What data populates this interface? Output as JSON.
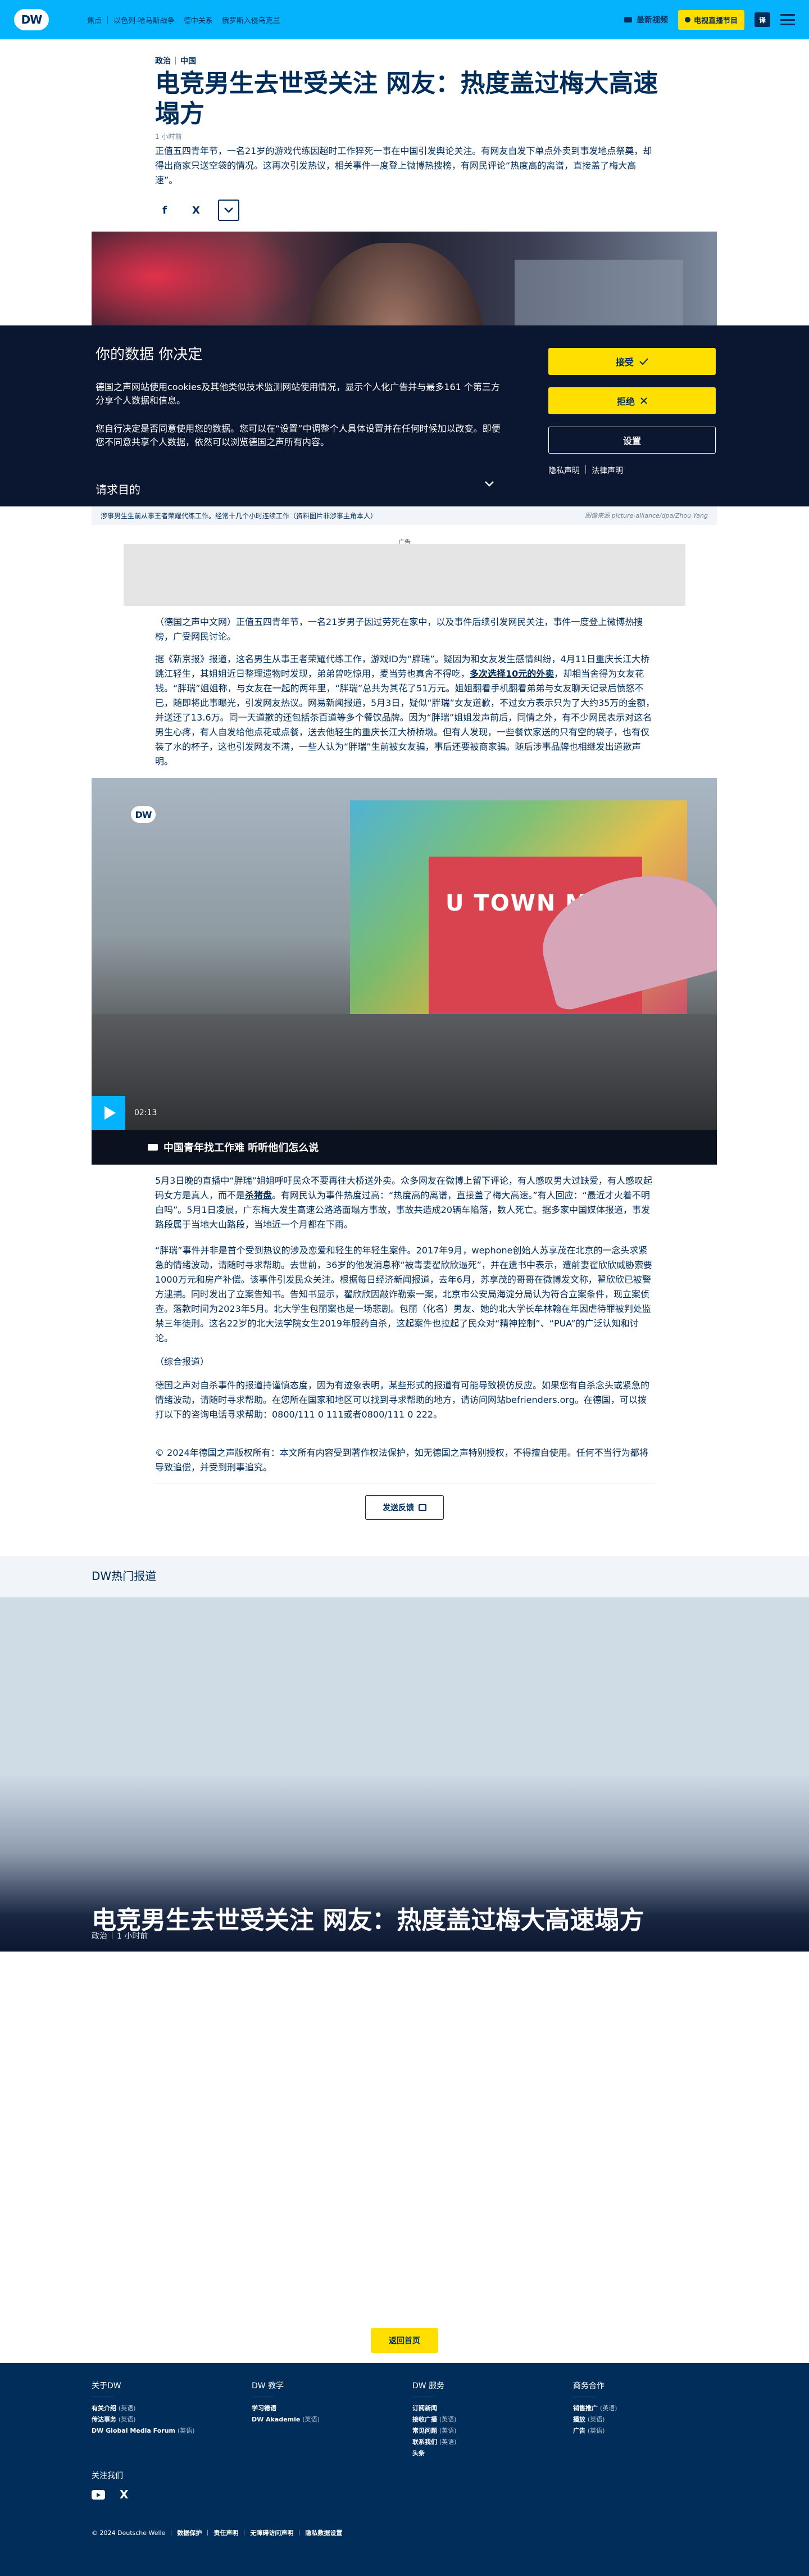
{
  "header": {
    "logo": "DW",
    "hot_label": "焦点",
    "hot_links": [
      "以色列-哈马斯战争",
      "德中关系",
      "俄罗斯入侵乌克兰"
    ],
    "latest_video": "最新视频",
    "tv_button": "电视直播节目",
    "lang": "译"
  },
  "article": {
    "kicker": [
      "政治",
      "中国"
    ],
    "title": "电竞男生去世受关注 网友：热度盖过梅大高速塌方",
    "time_ago": "1 小时前",
    "teaser": "正值五四青年节，一名21岁的游戏代练因超时工作猝死一事在中国引发舆论关注。有网友自发下单点外卖到事发地点祭奠，却得出商家只送空袋的情况。这再次引发热议，相关事件一度登上微博热搜榜，有网民评论“热度高的离谱，直接盖了梅大高速”。",
    "share": {
      "facebook": "f",
      "x": "X"
    },
    "hero_caption": "涉事男生生前从事王者荣耀代练工作。经常十几个小时连续工作（资料图片非涉事主角本人）",
    "hero_credit": "图像来源 picture-alliance/dpa/Zhou Yang"
  },
  "cookie": {
    "heading": "你的数据 你决定",
    "p1": "德国之声网站使用cookies及其他类似技术监测网站使用情况，显示个人化广告并与最多161 个第三方分享个人数据和信息。",
    "p2": "您自行决定是否同意使用您的数据。您可以在“设置”中调整个人具体设置并在任何时候加以改变。即便您不同意共享个人数据，依然可以浏览德国之声所有内容。",
    "purpose": "请求目的",
    "accept": "接受",
    "reject": "拒绝",
    "settings": "设置",
    "privacy": "隐私声明",
    "legal": "法律声明"
  },
  "ad": {
    "label": "广告"
  },
  "body": {
    "p1": "（德国之声中文网）正值五四青年节，一名21岁男子因过劳死在家中，以及事件后续引发网民关注，事件一度登上微博热搜榜，广受网民讨论。",
    "p2a": "据《新京报》报道，这名男生从事王者荣耀代练工作，游戏ID为“胖瑞”。疑因为和女友发生感情纠纷，4月11日重庆长江大桥跳江轻生，其姐姐近日整理遗物时发现，弟弟曾吃惊用，麦当劳也真舍不得吃，",
    "p2link": "多次选择10元的外卖",
    "p2b": "，却相当舍得为女友花钱。“胖瑞”姐姐称，与女友在一起的两年里，“胖瑞”总共为其花了51万元。姐姐翻看手机翻看弟弟与女友聊天记录后愤怒不已，随即将此事曝光，引发网友热议。网易新闻报道，5月3日，疑似“胖瑞”女友道歉，不过女方表示只为了大约35万的金额，并送还了13.6万。同一天道歉的还包括茶百道等多个餐饮品牌。因为“胖瑞”姐姐发声前后，同情之外，有不少网民表示对这名男生心疼，有人自发给他点花或点餐，送去他轻生的重庆长江大桥桥墩。但有人发现，一些餐饮家送的只有空的袋子，也有仅装了水的杯子，这也引发网友不满，一些人认为“胖瑞”生前被女友骗，事后还要被商家骗。随后涉事品牌也相继发出道歉声明。",
    "p3a": "5月3日晚的直播中“胖瑞”姐姐呼吁民众不要再往大桥送外卖。众多网友在微博上留下评论，有人感叹男大过缺爱，有人感叹起码女方是真人，而不是",
    "p3link": "杀猪盘",
    "p3b": "。有网民认为事件热度过高：“热度高的离谱，直接盖了梅大高速。”有人回应：“最近才火着不明白吗”。5月1日凌晨，广东梅大发生高速公路路面塌方事故，事故共造成20辆车陷落，数人死亡。据多家中国媒体报道，事发路段属于当地大山路段，当地近一个月都在下雨。",
    "p4": "“胖瑞”事件并非是首个受到热议的涉及恋爱和轻生的年轻生案件。2017年9月，wephone创始人苏享茂在北京的一念头求紧急的情绪波动，请随时寻求帮助。去世前，36岁的他发消息称“被毒妻翟欣欣逼死”，并在遗书中表示，遭前妻翟欣欣威胁索要1000万元和房产补偿。该事件引发民众关注。根据每日经济新闻报道，去年6月，苏享茂的哥哥在微博发文称，翟欣欣已被警方逮捕。同时发出了立案告知书。告知书显示，翟欣欣因敲诈勒索一案，北京市公安局海淀分局认为符合立案条件，现立案侦查。落款时间为2023年5月。北大学生包丽案也是一场悲剧。包丽（化名）男友、她的北大学长牟林翰在年因虐待罪被判处监禁三年徒刑。这名22岁的北大法学院女生2019年服药自杀，这起案件也拉起了民众对“精神控制”、“PUA”的广泛认知和讨论。",
    "p5": "（综合报道）",
    "p6": "德国之声对自杀事件的报道持谨慎态度，因为有迹象表明，某些形式的报道有可能导致模仿反应。如果您有自杀念头或紧急的情绪波动，请随时寻求帮助。在您所在国家和地区可以找到寻求帮助的地方，请访问网站befrienders.org。在德国，可以拨打以下的咨询电话寻求帮助：0800/111 0 111或者0800/111 0 222。",
    "p7": "© 2024年德国之声版权所有：本文所有内容受到著作权法保护，如无德国之声特别授权，不得擅自使用。任何不当行为都将导致追偿，并受到刑事追究。"
  },
  "video": {
    "logo": "DW",
    "time": "02:13",
    "title": "中国青年找工作难 听听他们怎么说",
    "mall_sign": "U TOWN MALL"
  },
  "feedback": {
    "label": "发送反馈"
  },
  "hot_section": {
    "title": "DW热门报道",
    "feature_title": "电竞男生去世受关注 网友：热度盖过梅大高速塌方",
    "feature_tag": "政治",
    "feature_time": "1 小时前"
  },
  "home_button": "返回首页",
  "footer": {
    "cols": [
      {
        "title": "关于DW",
        "items": [
          {
            "b": "有关介绍",
            "t": "(英语)"
          },
          {
            "b": "传达事务",
            "t": "(英语)"
          },
          {
            "b": "DW Global Media Forum",
            "t": "(英语)"
          }
        ]
      },
      {
        "title": "DW 教学",
        "items": [
          {
            "b": "学习德语",
            "t": ""
          },
          {
            "b": "DW Akademie",
            "t": "(英语)"
          }
        ]
      },
      {
        "title": "DW 服务",
        "items": [
          {
            "b": "订阅新闻",
            "t": ""
          },
          {
            "b": "接收广播",
            "t": "(英语)"
          },
          {
            "b": "常见问题",
            "t": "(英语)"
          },
          {
            "b": "联系我们",
            "t": "(英语)"
          },
          {
            "b": "头条",
            "t": ""
          }
        ]
      },
      {
        "title": "商务合作",
        "items": [
          {
            "b": "销售推广",
            "t": "(英语)"
          },
          {
            "b": "播放",
            "t": "(英语)"
          },
          {
            "b": "广告",
            "t": "(英语)"
          }
        ]
      }
    ],
    "follow": "关注我们",
    "legal": [
      "© 2024 Deutsche Welle",
      "数据保护",
      "责任声明",
      "无障碍访问声明",
      "隐私数据设置"
    ]
  },
  "colors": {
    "brand": "#05b2fc",
    "navy": "#002d5a",
    "accent": "#ffdf00"
  }
}
